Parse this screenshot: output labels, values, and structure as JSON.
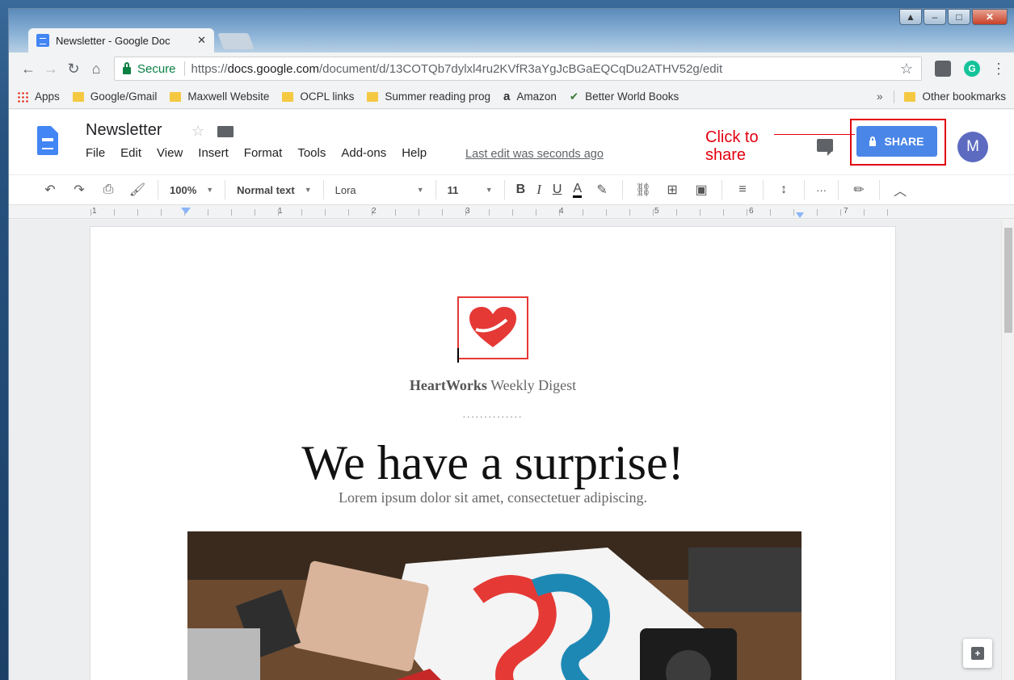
{
  "browser": {
    "tab_title": "Newsletter - Google Doc",
    "tab_close": "✕",
    "secure_label": "Secure",
    "url_scheme": "https://",
    "url_host": "docs.google.com",
    "url_path": "/document/d/13COTQb7dylxl4ru2KVfR3aYgJcBGaEQCqDu2ATHV52g/edit",
    "ext_grammarly": "G"
  },
  "bookmarks": {
    "items": [
      {
        "label": "Apps",
        "icon": "apps-grid-icon"
      },
      {
        "label": "Google/Gmail",
        "icon": "folder-icon"
      },
      {
        "label": "Maxwell Website",
        "icon": "folder-icon"
      },
      {
        "label": "OCPL links",
        "icon": "folder-icon"
      },
      {
        "label": "Summer reading prog",
        "icon": "folder-icon"
      },
      {
        "label": "Amazon",
        "icon": "amazon-icon"
      },
      {
        "label": "Better World Books",
        "icon": "bwb-icon"
      }
    ],
    "overflow": "»",
    "other": "Other bookmarks"
  },
  "docs": {
    "title": "Newsletter",
    "menu": [
      "File",
      "Edit",
      "View",
      "Insert",
      "Format",
      "Tools",
      "Add-ons",
      "Help"
    ],
    "last_edit": "Last edit was seconds ago",
    "share_label": "SHARE",
    "avatar_initial": "M",
    "annotation": "Click to share"
  },
  "toolbar": {
    "zoom": "100%",
    "style": "Normal text",
    "font": "Lora",
    "size": "11",
    "bold": "B",
    "italic": "I",
    "underline": "U",
    "text_color": "A",
    "more": "···"
  },
  "ruler": {
    "numbers": [
      "1",
      "1",
      "2",
      "3",
      "4",
      "5",
      "6",
      "7"
    ]
  },
  "document": {
    "brand_bold": "HeartWorks",
    "brand_rest": " Weekly Digest",
    "dots": "..............",
    "headline": "We have a surprise!",
    "subline": "Lorem ipsum dolor sit amet, consectetuer adipiscing."
  },
  "colors": {
    "share_blue": "#4a86e8",
    "annotation_red": "#e3000f",
    "docs_blue": "#4285f4",
    "heart_red": "#e53935"
  }
}
